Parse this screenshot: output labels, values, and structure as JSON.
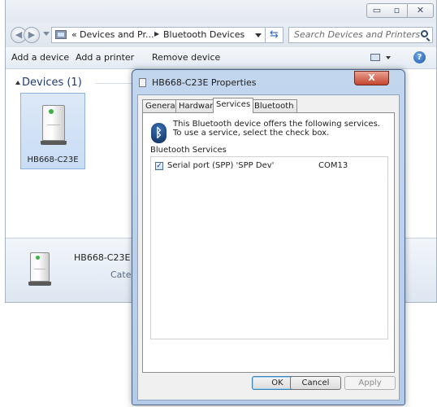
{
  "explorer": {
    "window_controls": {
      "minimize": "▭",
      "maximize": "▫",
      "close": "✕"
    },
    "breadcrumb": {
      "prefix": "«",
      "part1": "Devices and Pr...",
      "sep": "▶",
      "part2": "Bluetooth Devices"
    },
    "refresh_glyph": "⇆",
    "search_placeholder": "Search Devices and Printers",
    "commands": {
      "add_device": "Add a device",
      "add_printer": "Add a printer",
      "remove_device": "Remove device"
    },
    "help_glyph": "?",
    "group_header": "Devices (1)",
    "device_label": "HB668-C23E",
    "details": {
      "name": "HB668-C23E",
      "category_partial": "Categ"
    }
  },
  "dialog": {
    "title": "HB668-C23E Properties",
    "close_glyph": "X",
    "tabs": [
      "General",
      "Hardware",
      "Services",
      "Bluetooth"
    ],
    "active_tab": "Services",
    "bluetooth_glyph": "ᛒ",
    "info_text": "This Bluetooth device offers the following services. To use a service, select the check box.",
    "group_label": "Bluetooth Services",
    "services": [
      {
        "checked": "✓",
        "name": "Serial port (SPP) 'SPP Dev'",
        "port": "COM13"
      }
    ],
    "buttons": {
      "ok": "OK",
      "cancel": "Cancel",
      "apply": "Apply"
    }
  },
  "icons": [
    "back-arrow-icon",
    "forward-arrow-icon",
    "folder-icon",
    "refresh-icon",
    "search-icon",
    "view-icon",
    "help-icon",
    "device-box-icon",
    "bluetooth-icon",
    "checkbox-icon"
  ]
}
